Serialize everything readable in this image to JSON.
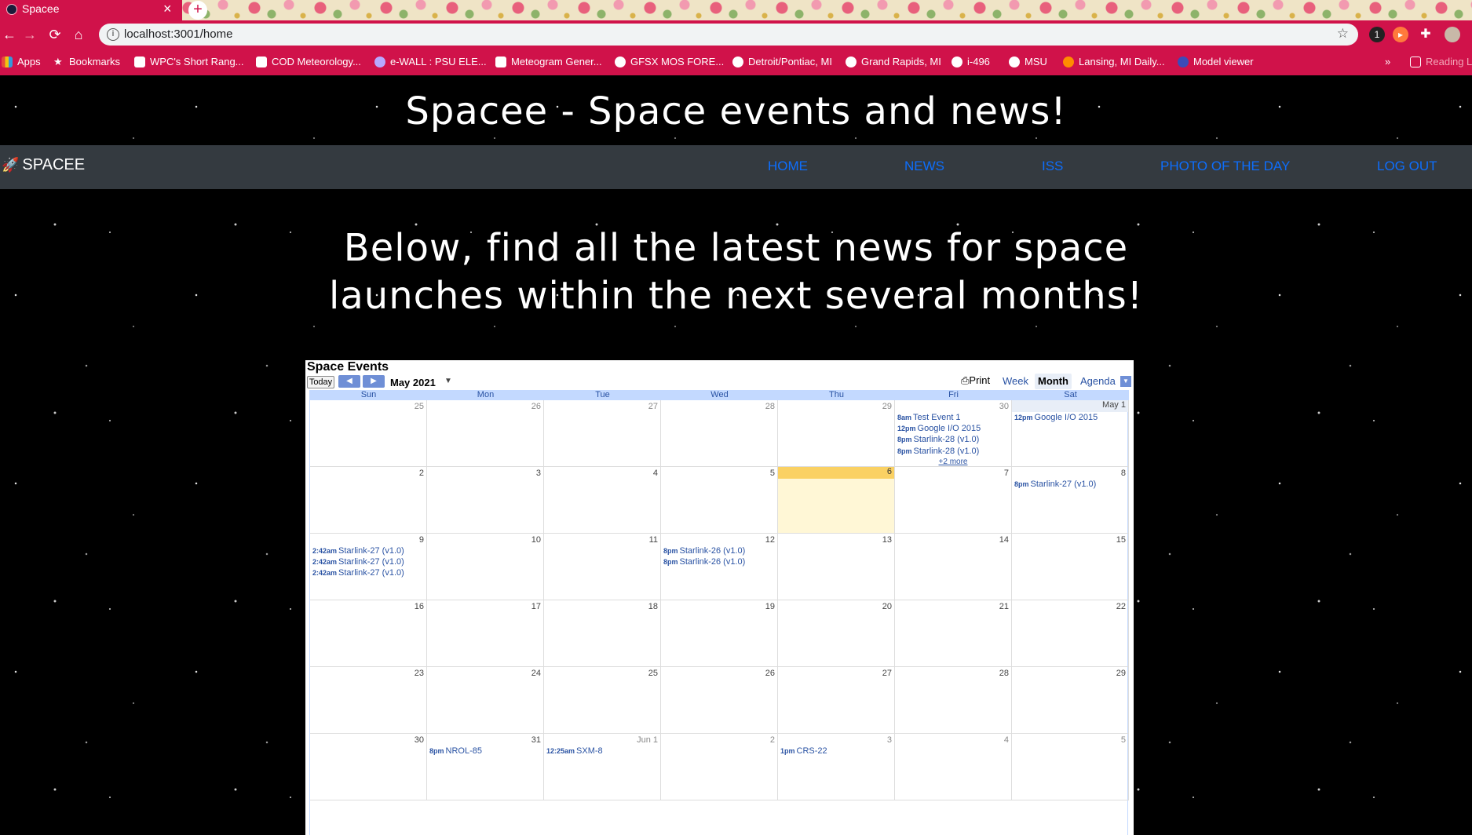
{
  "browser": {
    "tab_title": "Spacee",
    "url": "localhost:3001/home",
    "bookmarks": [
      "Apps",
      "Bookmarks",
      "WPC's Short Rang...",
      "COD Meteorology...",
      "e-WALL : PSU ELE...",
      "Meteogram Gener...",
      "GFSX MOS FORE...",
      "Detroit/Pontiac, MI",
      "Grand Rapids, MI",
      "i-496",
      "MSU",
      "Lansing, MI Daily...",
      "Model viewer"
    ],
    "overflow": "»",
    "reading_list": "Reading L"
  },
  "site": {
    "title": "Spacee - Space events and news!",
    "brand": "SPACEE",
    "nav": [
      "HOME",
      "NEWS",
      "ISS",
      "PHOTO OF THE DAY",
      "LOG OUT"
    ],
    "intro_line1": "Below, find all the latest news for space",
    "intro_line2": "launches within the next several months!"
  },
  "calendar": {
    "title": "Space Events",
    "today_label": "Today",
    "month_label": "May 2021",
    "print_label": "Print",
    "views": [
      "Week",
      "Month",
      "Agenda"
    ],
    "active_view": "Month",
    "day_names": [
      "Sun",
      "Mon",
      "Tue",
      "Wed",
      "Thu",
      "Fri",
      "Sat"
    ],
    "weeks": [
      [
        {
          "d": "25",
          "other": true
        },
        {
          "d": "26",
          "other": true
        },
        {
          "d": "27",
          "other": true
        },
        {
          "d": "28",
          "other": true
        },
        {
          "d": "29",
          "other": true
        },
        {
          "d": "30",
          "other": true,
          "events": [
            {
              "t": "8am",
              "n": "Test Event 1"
            },
            {
              "t": "12pm",
              "n": "Google I/O 2015"
            },
            {
              "t": "8pm",
              "n": "Starlink-28 (v1.0)"
            },
            {
              "t": "8pm",
              "n": "Starlink-28 (v1.0)"
            }
          ],
          "more": "+2 more"
        },
        {
          "d": "May 1",
          "strip": true,
          "events": [
            {
              "t": "12pm",
              "n": "Google I/O 2015"
            }
          ]
        }
      ],
      [
        {
          "d": "2"
        },
        {
          "d": "3"
        },
        {
          "d": "4"
        },
        {
          "d": "5"
        },
        {
          "d": "6",
          "today": true
        },
        {
          "d": "7"
        },
        {
          "d": "8",
          "events": [
            {
              "t": "8pm",
              "n": "Starlink-27 (v1.0)"
            }
          ]
        }
      ],
      [
        {
          "d": "9",
          "events": [
            {
              "t": "2:42am",
              "n": "Starlink-27 (v1.0)"
            },
            {
              "t": "2:42am",
              "n": "Starlink-27 (v1.0)"
            },
            {
              "t": "2:42am",
              "n": "Starlink-27 (v1.0)"
            }
          ]
        },
        {
          "d": "10"
        },
        {
          "d": "11"
        },
        {
          "d": "12",
          "events": [
            {
              "t": "8pm",
              "n": "Starlink-26 (v1.0)"
            },
            {
              "t": "8pm",
              "n": "Starlink-26 (v1.0)"
            }
          ]
        },
        {
          "d": "13"
        },
        {
          "d": "14"
        },
        {
          "d": "15"
        }
      ],
      [
        {
          "d": "16"
        },
        {
          "d": "17"
        },
        {
          "d": "18"
        },
        {
          "d": "19"
        },
        {
          "d": "20"
        },
        {
          "d": "21"
        },
        {
          "d": "22"
        }
      ],
      [
        {
          "d": "23"
        },
        {
          "d": "24"
        },
        {
          "d": "25"
        },
        {
          "d": "26"
        },
        {
          "d": "27"
        },
        {
          "d": "28"
        },
        {
          "d": "29"
        }
      ],
      [
        {
          "d": "30"
        },
        {
          "d": "31",
          "events": [
            {
              "t": "8pm",
              "n": "NROL-85"
            }
          ]
        },
        {
          "d": "Jun 1",
          "other": true,
          "events": [
            {
              "t": "12:25am",
              "n": "SXM-8"
            }
          ]
        },
        {
          "d": "2",
          "other": true
        },
        {
          "d": "3",
          "other": true,
          "events": [
            {
              "t": "1pm",
              "n": "CRS-22"
            }
          ]
        },
        {
          "d": "4",
          "other": true
        },
        {
          "d": "5",
          "other": true
        }
      ]
    ]
  },
  "colors": {
    "chrome": "#d0124a",
    "navbar": "#343a40",
    "nav_link": "#0d6efd",
    "event_text": "#2952a3",
    "today_highlight": "#fad163"
  }
}
